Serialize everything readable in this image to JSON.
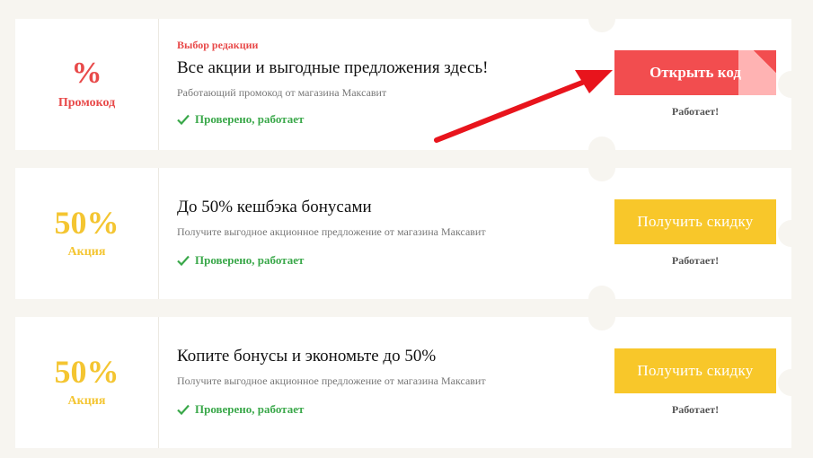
{
  "coupons": [
    {
      "badge": "%",
      "type": "Промокод",
      "editor_label": "Выбор редакции",
      "title": "Все акции и выгодные предложения здесь!",
      "description": "Работающий промокод от магазина Максавит",
      "verified": "Проверено, работает",
      "button": "Открыть код",
      "status": "Работает!"
    },
    {
      "badge": "50%",
      "type": "Акция",
      "title": "До 50% кешбэка бонусами",
      "description": "Получите выгодное акционное предложение от магазина Максавит",
      "verified": "Проверено, работает",
      "button": "Получить скидку",
      "status": "Работает!"
    },
    {
      "badge": "50%",
      "type": "Акция",
      "title": "Копите бонусы и экономьте до 50%",
      "description": "Получите выгодное акционное предложение от магазина Максавит",
      "verified": "Проверено, работает",
      "button": "Получить скидку",
      "status": "Работает!"
    }
  ],
  "colors": {
    "promo_red": "#f24d4f",
    "deal_yellow": "#f8c72a",
    "verified_green": "#3aa84a",
    "annotation_arrow": "#e8141c"
  },
  "icons": [
    "check-icon",
    "annotation-arrow"
  ]
}
